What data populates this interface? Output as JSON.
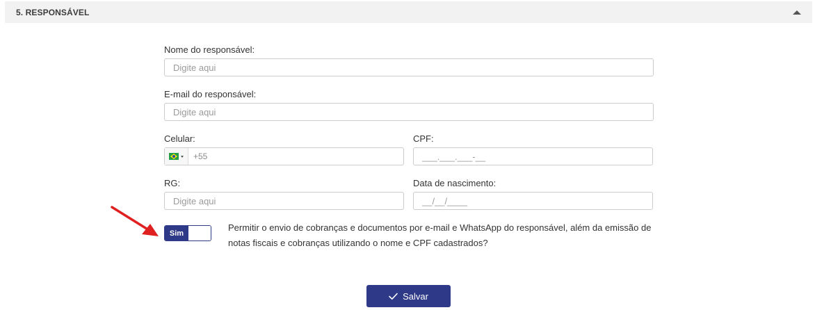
{
  "section": {
    "title": "5. RESPONSÁVEL",
    "collapse_icon": "caret-up-icon"
  },
  "form": {
    "name": {
      "label": "Nome do responsável:",
      "placeholder": "Digite aqui",
      "value": ""
    },
    "email": {
      "label": "E-mail do responsável:",
      "placeholder": "Digite aqui",
      "value": ""
    },
    "phone": {
      "label": "Celular:",
      "country_flag": "brazil-flag-icon",
      "placeholder": "+55",
      "value": ""
    },
    "cpf": {
      "label": "CPF:",
      "placeholder": "___.___.___-__",
      "value": ""
    },
    "rg": {
      "label": "RG:",
      "placeholder": "Digite aqui",
      "value": ""
    },
    "birthdate": {
      "label": "Data de nascimento:",
      "placeholder": "__/__/____",
      "value": ""
    },
    "consent": {
      "toggle_label": "Sim",
      "toggle_state": true,
      "text": "Permitir o envio de cobranças e documentos por e-mail e WhatsApp do responsável, além da emissão de notas fiscais e cobranças utilizando o nome e CPF cadastrados?"
    }
  },
  "actions": {
    "save_label": "Salvar",
    "save_icon": "check-icon"
  },
  "colors": {
    "primary": "#2e3a87",
    "header_bg": "#f2f2f2",
    "annotation_arrow": "#e02020"
  }
}
